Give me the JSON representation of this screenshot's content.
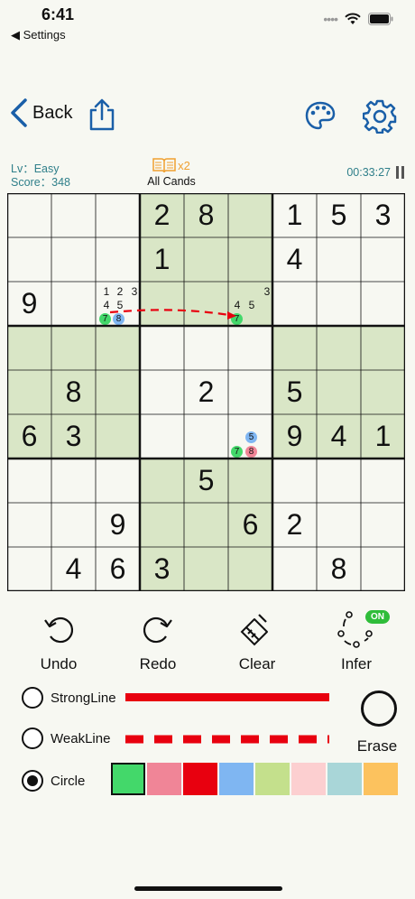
{
  "status_bar": {
    "time": "6:41",
    "back_app": "◀ Settings"
  },
  "nav": {
    "back_label": "Back"
  },
  "info": {
    "level": "Lv：Easy",
    "score": "Score：348",
    "multiplier": "x2",
    "mode": "All Cands",
    "timer": "00:33:27"
  },
  "board": {
    "given": [
      [
        "",
        "",
        "",
        "2",
        "8",
        "",
        "1",
        "5",
        "3"
      ],
      [
        "",
        "",
        "",
        "1",
        "",
        "",
        "4",
        "",
        ""
      ],
      [
        "9",
        "",
        "",
        "",
        "",
        "",
        "",
        "",
        ""
      ],
      [
        "",
        "",
        "",
        "",
        "",
        "",
        "",
        "",
        ""
      ],
      [
        "",
        "8",
        "",
        "",
        "2",
        "",
        "5",
        "",
        ""
      ],
      [
        "6",
        "3",
        "",
        "",
        "",
        "",
        "9",
        "4",
        "1"
      ],
      [
        "",
        "",
        "",
        "",
        "5",
        "",
        "",
        "",
        ""
      ],
      [
        "",
        "",
        "9",
        "",
        "",
        "6",
        "2",
        "",
        ""
      ],
      [
        "",
        "4",
        "6",
        "3",
        "",
        "",
        "",
        "8",
        ""
      ]
    ],
    "candidates_r3c3": [
      "1",
      "2",
      "3",
      "4",
      "5"
    ],
    "candidates_r3c6": [
      "3",
      "4",
      "5"
    ],
    "marks": {
      "r3c3_a": "7",
      "r3c3_b": "8",
      "r3c6": "7",
      "r6c6_a": "5",
      "r6c6_b": "7",
      "r6c6_c": "8"
    }
  },
  "tools": {
    "undo": "Undo",
    "redo": "Redo",
    "clear": "Clear",
    "infer": "Infer",
    "infer_toggle": "ON"
  },
  "options": {
    "strong_line": "StrongLine",
    "weak_line": "WeakLine",
    "circle": "Circle",
    "erase": "Erase"
  },
  "colors": {
    "swatches": [
      "#43d86a",
      "#f08597",
      "#e8000f",
      "#7fb6f2",
      "#c4e08c",
      "#fccfd0",
      "#a9d6d8",
      "#fcc25e"
    ],
    "accent": "#1a5fa8",
    "box_shade": "#d9e6c6",
    "line_red": "#e8000f"
  }
}
